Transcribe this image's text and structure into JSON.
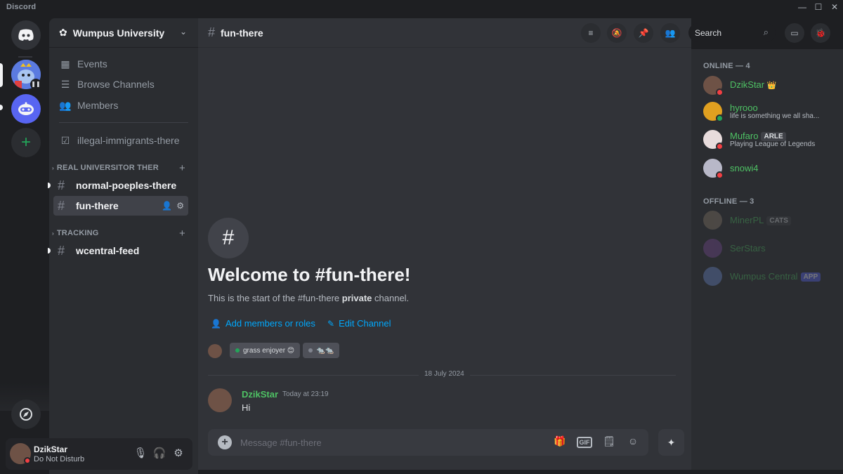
{
  "window": {
    "app_title": "Discord",
    "minimize": "—",
    "maximize": "☐",
    "close": "✕"
  },
  "guild": {
    "name": "Wumpus University"
  },
  "sidebar": {
    "nav": [
      {
        "label": "Events",
        "icon": "calendar-icon"
      },
      {
        "label": "Browse Channels",
        "icon": "browse-channels-icon"
      },
      {
        "label": "Members",
        "icon": "members-icon"
      }
    ],
    "top_channel": "illegal-immigrants-there",
    "categories": [
      {
        "label": "REAL UNIVERSITOR THER",
        "channels": [
          "normal-poeples-there",
          "fun-there"
        ]
      },
      {
        "label": "TRACKING",
        "channels": [
          "wcentral-feed"
        ]
      }
    ]
  },
  "user_panel": {
    "name": "DzikStar",
    "status": "Do Not Disturb"
  },
  "channel": {
    "name": "fun-there"
  },
  "search": {
    "placeholder": "Search"
  },
  "welcome": {
    "title": "Welcome to #fun-there!",
    "desc_prefix": "This is the start of the #fun-there ",
    "desc_bold": "private",
    "desc_suffix": " channel.",
    "add_members": "Add members or roles",
    "edit_channel": "Edit Channel",
    "chip1": "grass enjoyer 😊",
    "chip2": "🐀🐀"
  },
  "messages": {
    "date": "18 July 2024",
    "items": [
      {
        "author": "DzikStar",
        "time": "Today at 23:19",
        "text": "Hi"
      }
    ]
  },
  "composer": {
    "placeholder": "Message #fun-there"
  },
  "members": {
    "online_header": "ONLINE — 4",
    "offline_header": "OFFLINE — 3",
    "online": [
      {
        "name": "DzikStar",
        "sub": "",
        "badge": "👑"
      },
      {
        "name": "hyrooo",
        "sub": "life is something we all sha...",
        "badge": ""
      },
      {
        "name": "Mufaro",
        "sub": "Playing League of Legends",
        "badge": "ARLE"
      },
      {
        "name": "snowi4",
        "sub": "",
        "badge": ""
      }
    ],
    "offline": [
      {
        "name": "MinerPL",
        "badge": "CATS"
      },
      {
        "name": "SerStars",
        "badge": ""
      },
      {
        "name": "Wumpus Central",
        "badge": "APP"
      }
    ]
  },
  "colors": {
    "accent": "#5865f2",
    "online": "#23a559",
    "dnd": "#f23f43",
    "link": "#00a8fc",
    "name_green": "#4ec264"
  }
}
